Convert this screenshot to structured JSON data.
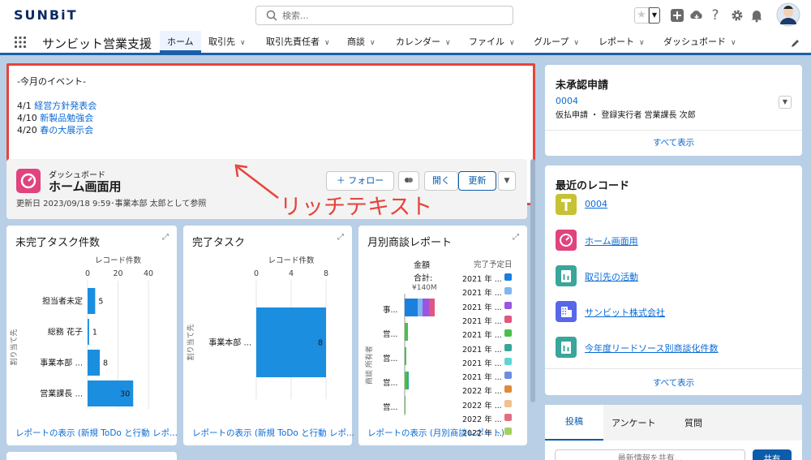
{
  "app": {
    "logo": "SUNBiT",
    "name": "サンビット営業支援",
    "search_placeholder": "検索..."
  },
  "nav": {
    "tabs": [
      {
        "label": "ホーム",
        "active": true
      },
      {
        "label": "取引先"
      },
      {
        "label": "取引先責任者"
      },
      {
        "label": "商談"
      },
      {
        "label": "カレンダー"
      },
      {
        "label": "ファイル"
      },
      {
        "label": "グループ"
      },
      {
        "label": "レポート"
      },
      {
        "label": "ダッシュボード"
      }
    ]
  },
  "richtext": {
    "heading": "-今月のイベント-",
    "events": [
      {
        "date": "4/1",
        "title": "経営方針発表会"
      },
      {
        "date": "4/10",
        "title": "新製品勉強会"
      },
      {
        "date": "4/20",
        "title": "春の大展示会"
      }
    ]
  },
  "annotation": "リッチテキスト",
  "dashboard": {
    "label": "ダッシュボード",
    "title": "ホーム画面用",
    "meta": "更新日 2023/09/18 9:59･事業本部 太郎として参照",
    "follow": "＋ フォロー",
    "open": "開く",
    "refresh": "更新"
  },
  "panels": {
    "incomplete": {
      "title": "未完了タスク件数",
      "footer": "レポートの表示 (新規 ToDo と行動 レポ..."
    },
    "complete": {
      "title": "完了タスク",
      "footer": "レポートの表示 (新規 ToDo と行動 レポ..."
    },
    "monthly": {
      "title": "月別商談レポート",
      "footer": "レポートの表示 (月別商談レポート)",
      "amount_label": "金額",
      "total_label": "合計:",
      "total_value": "¥140M",
      "ylabel": "商談 所有者",
      "legend_title": "完了予定日",
      "legend": [
        {
          "label": "2021 年 ...",
          "color": "#1b7fe0"
        },
        {
          "label": "2021 年 ...",
          "color": "#7fb6f0"
        },
        {
          "label": "2021 年 ...",
          "color": "#9b55e0"
        },
        {
          "label": "2021 年 ...",
          "color": "#e0567e"
        },
        {
          "label": "2021 年 ...",
          "color": "#4bbf4b"
        },
        {
          "label": "2021 年 ...",
          "color": "#3aa59a"
        },
        {
          "label": "2021 年 ...",
          "color": "#5fd4d4"
        },
        {
          "label": "2021 年 ...",
          "color": "#6f8ce0"
        },
        {
          "label": "2022 年 ...",
          "color": "#e08a3a"
        },
        {
          "label": "2022 年 ...",
          "color": "#f0c090"
        },
        {
          "label": "2022 年 ...",
          "color": "#e07080"
        },
        {
          "label": "2022 年 ...",
          "color": "#a3d060"
        }
      ],
      "rows": [
        "事...",
        "営...",
        "営...",
        "営...",
        "営..."
      ]
    }
  },
  "chart_data": [
    {
      "type": "bar",
      "orientation": "horizontal",
      "title": "未完了タスク件数",
      "xlabel": "レコード件数",
      "ylabel": "割り当て先",
      "categories": [
        "担当者未定",
        "総務 花子",
        "事業本部 ...",
        "営業課長 ..."
      ],
      "values": [
        5,
        1,
        8,
        30
      ],
      "xlim": [
        0,
        40
      ],
      "ticks": [
        "0",
        "20",
        "40"
      ]
    },
    {
      "type": "bar",
      "orientation": "horizontal",
      "title": "完了タスク",
      "xlabel": "レコード件数",
      "ylabel": "割り当て先",
      "categories": [
        "事業本部 ..."
      ],
      "values": [
        8
      ],
      "xlim": [
        0,
        8
      ],
      "ticks": [
        "0",
        "4",
        "8"
      ]
    }
  ],
  "approvals": {
    "title": "未承認申請",
    "id": "0004",
    "detail": "仮払申請 ・ 登録実行者 営業課長 次郎",
    "view_all": "すべて表示"
  },
  "recent": {
    "title": "最近のレコード",
    "items": [
      {
        "label": "0004",
        "color": "#c7c233"
      },
      {
        "label": "ホーム画面用",
        "color": "#e0437e"
      },
      {
        "label": "取引先の活動",
        "color": "#3aa59a"
      },
      {
        "label": "サンビット株式会社",
        "color": "#5867e8"
      },
      {
        "label": "今年度リードソース別商談化件数",
        "color": "#3aa59a"
      }
    ],
    "view_all": "すべて表示"
  },
  "feed": {
    "tabs": [
      "投稿",
      "アンケート",
      "質問"
    ],
    "placeholder": "最新情報を共有...",
    "share": "共有"
  }
}
